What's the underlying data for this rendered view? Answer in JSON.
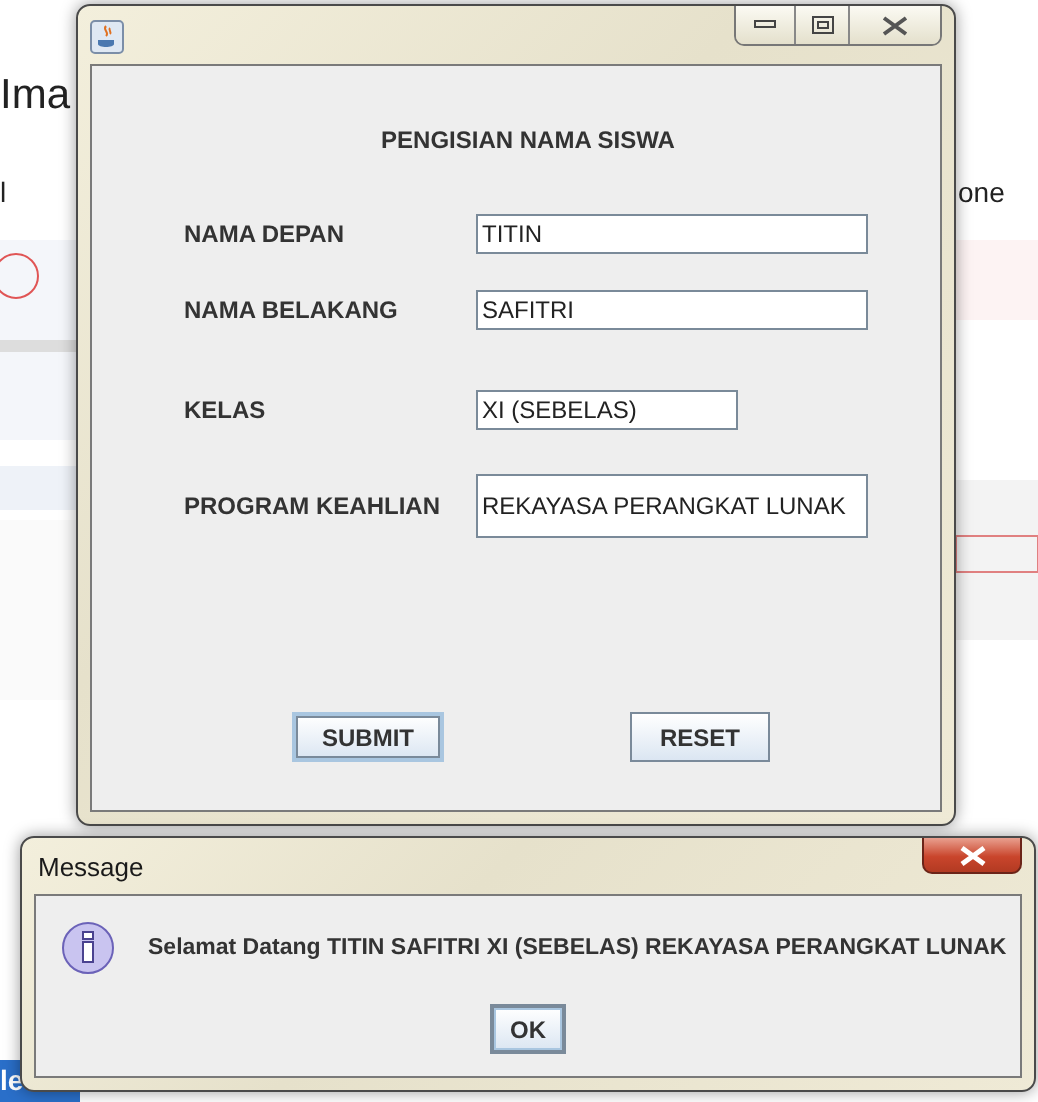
{
  "background": {
    "heading_fragment": "Ima",
    "tab_fragment": "l",
    "right_fragment": "one",
    "taskbar_fragment": "le"
  },
  "form_window": {
    "title": "PENGISIAN NAMA SISWA",
    "fields": [
      {
        "label": "NAMA DEPAN",
        "value": "TITIN"
      },
      {
        "label": "NAMA BELAKANG",
        "value": "SAFITRI"
      },
      {
        "label": "KELAS",
        "value": "XI (SEBELAS)"
      },
      {
        "label": "PROGRAM KEAHLIAN",
        "value": "REKAYASA PERANGKAT LUNAK"
      }
    ],
    "buttons": [
      {
        "label": "SUBMIT",
        "focused": true
      },
      {
        "label": "RESET",
        "focused": false
      }
    ]
  },
  "message_dialog": {
    "title": "Message",
    "message": "Selamat Datang TITIN SAFITRI XI (SEBELAS) REKAYASA PERANGKAT LUNAK",
    "button": "OK"
  }
}
